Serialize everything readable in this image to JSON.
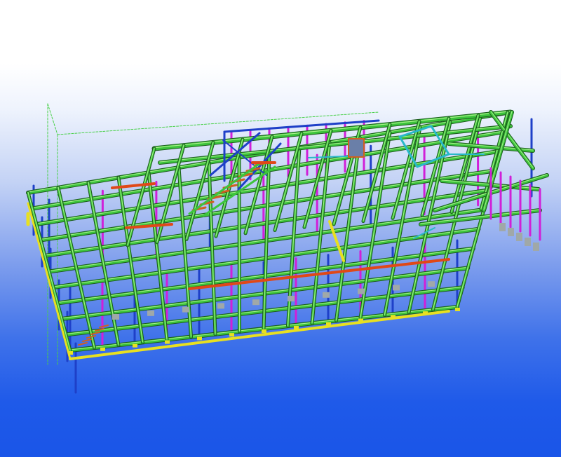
{
  "viewport": {
    "kind": "3d-structural-model-view",
    "background_top_color": "#ffffff",
    "background_bottom_color": "#1a55e8"
  },
  "model": {
    "colors": {
      "beam": "#3cc43c",
      "beam_highlight": "#a8f08a",
      "column_blue": "#1e40c8",
      "column_magenta": "#d020d8",
      "base_plate": "#e8e020",
      "rafter_orange": "#e04818",
      "bracing_cyan": "#28b8c8",
      "work_area_box": "#48d048",
      "foundation_grey": "#a0a8a8",
      "stair_rail": "#d06020"
    },
    "parts": [
      "work-area-box",
      "roof-beams",
      "columns",
      "diagonal-bracing",
      "base-plates",
      "stairs",
      "cyan-bracing-frame",
      "lift-cage"
    ]
  }
}
